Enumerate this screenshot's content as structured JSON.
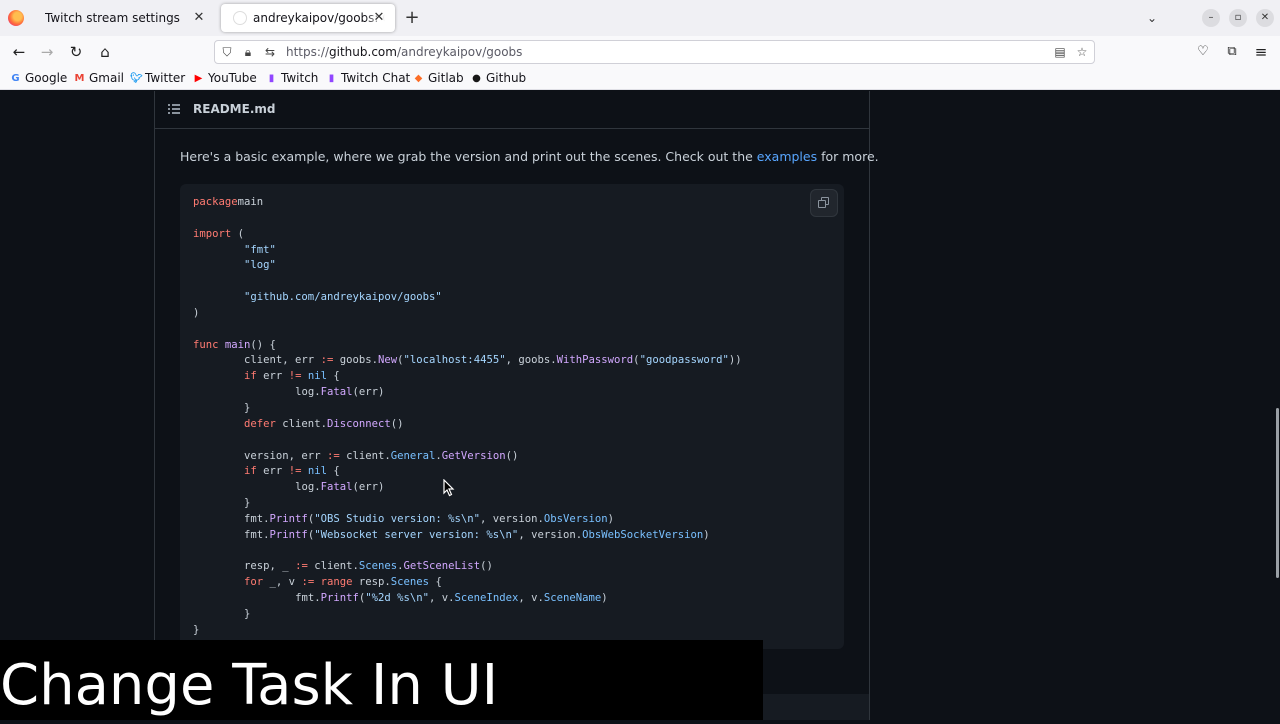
{
  "browser": {
    "tabs": [
      {
        "title": "Twitch stream settings",
        "active": false
      },
      {
        "title": "andreykaipov/goobs: Go client library for OBS",
        "active": true
      }
    ],
    "url": {
      "prefix": "https://",
      "domain": "github.com",
      "path": "/andreykaipov/goobs"
    },
    "bookmarks": [
      {
        "label": "Google",
        "icon": "google-icon",
        "color": "#4285f4"
      },
      {
        "label": "Gmail",
        "icon": "gmail-icon",
        "color": "#ea4335"
      },
      {
        "label": "Twitter",
        "icon": "twitter-icon",
        "color": "#1d9bf0"
      },
      {
        "label": "YouTube",
        "icon": "youtube-icon",
        "color": "#ff0000"
      },
      {
        "label": "Twitch",
        "icon": "twitch-icon",
        "color": "#9146ff"
      },
      {
        "label": "Twitch Chat",
        "icon": "twitch-icon",
        "color": "#9146ff"
      },
      {
        "label": "Gitlab",
        "icon": "gitlab-icon",
        "color": "#fc6d26"
      },
      {
        "label": "Github",
        "icon": "github-icon",
        "color": "#181717"
      }
    ]
  },
  "readme": {
    "filename": "README.md",
    "intro_before": "Here's a basic example, where we grab the version and print out the scenes. Check out the ",
    "intro_link": "examples",
    "intro_after": " for more."
  },
  "code": {
    "language": "go",
    "lines": [
      [
        [
          "kw",
          "package"
        ],
        [
          "",
          "main"
        ]
      ],
      [],
      [
        [
          "kw",
          "import"
        ],
        [
          "",
          " ("
        ]
      ],
      [
        [
          "",
          "\t"
        ],
        [
          "str",
          "\"fmt\""
        ]
      ],
      [
        [
          "",
          "\t"
        ],
        [
          "str",
          "\"log\""
        ]
      ],
      [],
      [
        [
          "",
          "\t"
        ],
        [
          "str",
          "\"github.com/andreykaipov/goobs\""
        ]
      ],
      [
        [
          "",
          ")"
        ]
      ],
      [],
      [
        [
          "kw",
          "func"
        ],
        [
          "",
          " "
        ],
        [
          "fn",
          "main"
        ],
        [
          "",
          "() {"
        ]
      ],
      [
        [
          "",
          "\tclient, err "
        ],
        [
          "kw",
          ":="
        ],
        [
          "",
          " goobs."
        ],
        [
          "fn",
          "New"
        ],
        [
          "",
          "("
        ],
        [
          "str",
          "\"localhost:4455\""
        ],
        [
          "",
          ", goobs."
        ],
        [
          "fn",
          "WithPassword"
        ],
        [
          "",
          "("
        ],
        [
          "str",
          "\"goodpassword\""
        ],
        [
          "",
          "))"
        ]
      ],
      [
        [
          "",
          "\t"
        ],
        [
          "kw",
          "if"
        ],
        [
          "",
          " err "
        ],
        [
          "kw",
          "!="
        ],
        [
          "",
          " "
        ],
        [
          "mem",
          "nil"
        ],
        [
          "",
          " {"
        ]
      ],
      [
        [
          "",
          "\t\tlog."
        ],
        [
          "fn",
          "Fatal"
        ],
        [
          "",
          "(err)"
        ]
      ],
      [
        [
          "",
          "\t}"
        ]
      ],
      [
        [
          "",
          "\t"
        ],
        [
          "kw",
          "defer"
        ],
        [
          "",
          " client."
        ],
        [
          "fn",
          "Disconnect"
        ],
        [
          "",
          "()"
        ]
      ],
      [],
      [
        [
          "",
          "\tversion, err "
        ],
        [
          "kw",
          ":="
        ],
        [
          "",
          " client."
        ],
        [
          "mem",
          "General"
        ],
        [
          "",
          "."
        ],
        [
          "fn",
          "GetVersion"
        ],
        [
          "",
          "()"
        ]
      ],
      [
        [
          "",
          "\t"
        ],
        [
          "kw",
          "if"
        ],
        [
          "",
          " err "
        ],
        [
          "kw",
          "!="
        ],
        [
          "",
          " "
        ],
        [
          "mem",
          "nil"
        ],
        [
          "",
          " {"
        ]
      ],
      [
        [
          "",
          "\t\tlog."
        ],
        [
          "fn",
          "Fatal"
        ],
        [
          "",
          "(err)"
        ]
      ],
      [
        [
          "",
          "\t}"
        ]
      ],
      [
        [
          "",
          "\tfmt."
        ],
        [
          "fn",
          "Printf"
        ],
        [
          "",
          "("
        ],
        [
          "str",
          "\"OBS Studio version: %s\\n\""
        ],
        [
          "",
          ", version."
        ],
        [
          "mem",
          "ObsVersion"
        ],
        [
          "",
          ")"
        ]
      ],
      [
        [
          "",
          "\tfmt."
        ],
        [
          "fn",
          "Printf"
        ],
        [
          "",
          "("
        ],
        [
          "str",
          "\"Websocket server version: %s\\n\""
        ],
        [
          "",
          ", version."
        ],
        [
          "mem",
          "ObsWebSocketVersion"
        ],
        [
          "",
          ")"
        ]
      ],
      [],
      [
        [
          "",
          "\tresp, _ "
        ],
        [
          "kw",
          ":="
        ],
        [
          "",
          " client."
        ],
        [
          "mem",
          "Scenes"
        ],
        [
          "",
          "."
        ],
        [
          "fn",
          "GetSceneList"
        ],
        [
          "",
          "()"
        ]
      ],
      [
        [
          "",
          "\t"
        ],
        [
          "kw",
          "for"
        ],
        [
          "",
          " _, v "
        ],
        [
          "kw",
          ":="
        ],
        [
          "",
          " "
        ],
        [
          "kw",
          "range"
        ],
        [
          "",
          " resp."
        ],
        [
          "mem",
          "Scenes"
        ],
        [
          "",
          " {"
        ]
      ],
      [
        [
          "",
          "\t\tfmt."
        ],
        [
          "fn",
          "Printf"
        ],
        [
          "",
          "("
        ],
        [
          "str",
          "\"%2d %s\\n\""
        ],
        [
          "",
          ", v."
        ],
        [
          "mem",
          "SceneIndex"
        ],
        [
          "",
          ", v."
        ],
        [
          "mem",
          "SceneName"
        ],
        [
          "",
          ")"
        ]
      ],
      [
        [
          "",
          "\t}"
        ]
      ],
      [
        [
          "",
          "}"
        ]
      ]
    ]
  },
  "overlay": {
    "caption": "Change Task In UI"
  }
}
